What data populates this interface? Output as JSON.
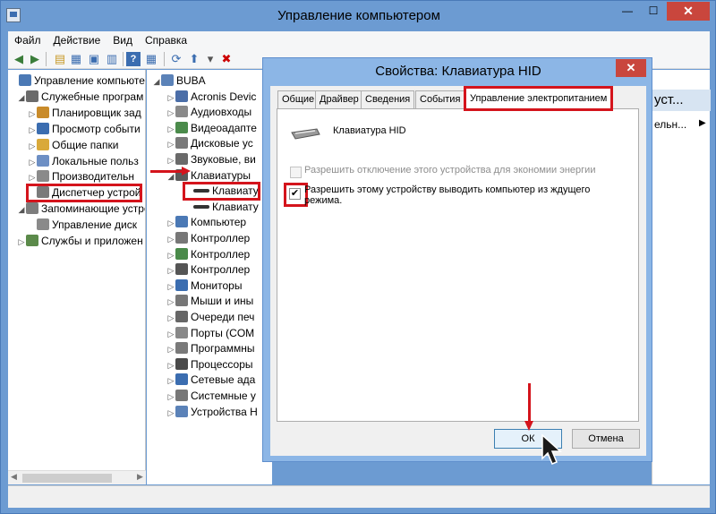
{
  "window": {
    "title": "Управление компьютером",
    "btn_min": "—",
    "btn_max": "☐",
    "btn_close": "✕"
  },
  "menu": [
    "Файл",
    "Действие",
    "Вид",
    "Справка"
  ],
  "left_tree": [
    {
      "label": "Управление компьютер",
      "icon": "computer-manage-icon"
    },
    {
      "label": "Служебные програм",
      "icon": "tools-icon"
    },
    {
      "label": "Планировщик зад",
      "icon": "clock-icon"
    },
    {
      "label": "Просмотр событи",
      "icon": "event-viewer-icon"
    },
    {
      "label": "Общие папки",
      "icon": "folder-icon"
    },
    {
      "label": "Локальные польз",
      "icon": "users-icon"
    },
    {
      "label": "Производительн",
      "icon": "performance-icon"
    },
    {
      "label": "Диспетчер устрой",
      "icon": "device-manager-icon"
    },
    {
      "label": "Запоминающие устро",
      "icon": "storage-icon"
    },
    {
      "label": "Управление диск",
      "icon": "disk-icon"
    },
    {
      "label": "Службы и приложен",
      "icon": "services-icon"
    }
  ],
  "mid_tree": [
    {
      "label": "BUBA",
      "icon": "computer-icon"
    },
    {
      "label": "Acronis Devic",
      "icon": "acronis-icon"
    },
    {
      "label": "Аудиовходы",
      "icon": "audio-icon"
    },
    {
      "label": "Видеоадапте",
      "icon": "video-icon"
    },
    {
      "label": "Дисковые ус",
      "icon": "disk-drive-icon"
    },
    {
      "label": "Звуковые, ви",
      "icon": "sound-icon"
    },
    {
      "label": "Клавиатуры",
      "icon": "keyboard-icon"
    },
    {
      "label": "Клавиату",
      "icon": "keyboard-icon"
    },
    {
      "label": "Клавиату",
      "icon": "keyboard-icon"
    },
    {
      "label": "Компьютер",
      "icon": "computer-icon"
    },
    {
      "label": "Контроллер",
      "icon": "controller-icon"
    },
    {
      "label": "Контроллер",
      "icon": "controller-icon"
    },
    {
      "label": "Контроллер",
      "icon": "usb-icon"
    },
    {
      "label": "Мониторы",
      "icon": "monitor-icon"
    },
    {
      "label": "Мыши и ины",
      "icon": "mouse-icon"
    },
    {
      "label": "Очереди печ",
      "icon": "printer-icon"
    },
    {
      "label": "Порты (COM",
      "icon": "port-icon"
    },
    {
      "label": "Программны",
      "icon": "software-icon"
    },
    {
      "label": "Процессоры",
      "icon": "cpu-icon"
    },
    {
      "label": "Сетевые ада",
      "icon": "network-icon"
    },
    {
      "label": "Системные у",
      "icon": "system-icon"
    },
    {
      "label": "Устройства H",
      "icon": "hid-icon"
    }
  ],
  "right_pane": {
    "heading": "уст...",
    "sub": "ельн..."
  },
  "dialog": {
    "title": "Свойства: Клавиатура HID",
    "close": "✕",
    "tabs": [
      "Общие",
      "Драйвер",
      "Сведения",
      "События",
      "Управление электропитанием"
    ],
    "device_name": "Клавиатура HID",
    "option1": "Разрешить отключение этого устройства для экономии энергии",
    "option2": "Разрешить этому устройству выводить компьютер из ждущего режима.",
    "ok": "ОК",
    "cancel": "Отмена"
  },
  "colors": {
    "highlight": "#d4141c",
    "titlebar": "#6c9bd2",
    "dialog_frame": "#8cb6e6"
  }
}
